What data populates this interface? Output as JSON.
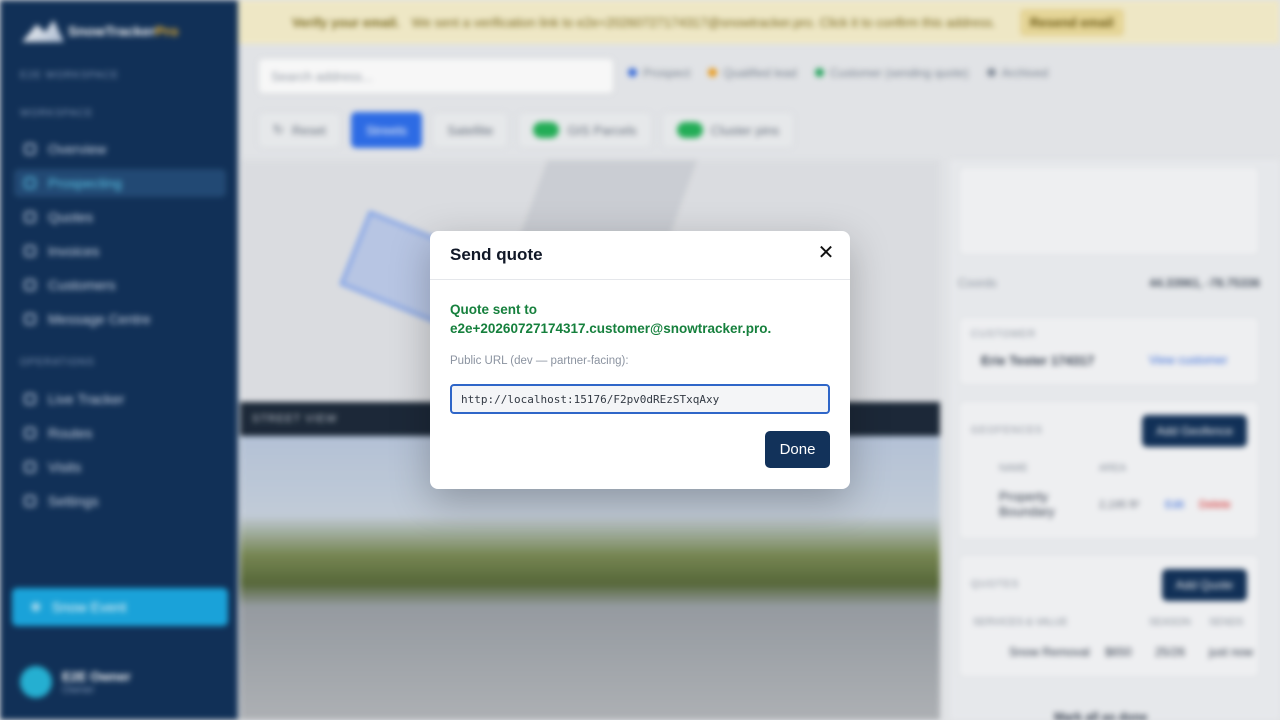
{
  "background": {
    "brand": {
      "name_a": "SnowTracker",
      "name_b": "Pro"
    },
    "workspace_label": "E2E WORKSPACE",
    "sections": {
      "workspace": "WORKSPACE",
      "operations": "OPERATIONS"
    },
    "nav": [
      {
        "label": "Overview"
      },
      {
        "label": "Prospecting"
      },
      {
        "label": "Quotes"
      },
      {
        "label": "Invoices"
      },
      {
        "label": "Customers"
      },
      {
        "label": "Message Centre"
      },
      {
        "label": "Live Tracker"
      },
      {
        "label": "Routes"
      },
      {
        "label": "Visits"
      },
      {
        "label": "Settings"
      }
    ],
    "snow_event_label": "Snow Event",
    "user": {
      "name": "E2E Owner",
      "role": "Owner"
    },
    "banner": {
      "title": "Verify your email.",
      "message": "We sent a verification link to e2e+20260727174317@snowtracker.pro. Click it to confirm this address.",
      "resend": "Resend email"
    },
    "search_placeholder": "Search address...",
    "legend": [
      {
        "label": "Prospect",
        "color": "#3b6fe0"
      },
      {
        "label": "Qualified lead",
        "color": "#f0a020"
      },
      {
        "label": "Customer (sending quote)",
        "color": "#25a860"
      },
      {
        "label": "Archived",
        "color": "#8a93a0"
      }
    ],
    "toolbar": {
      "reset": "Reset",
      "streets": "Streets",
      "satellite": "Satellite",
      "parcels": "GIS Parcels",
      "cluster": "Cluster pins"
    },
    "street_view_label": "STREET VIEW",
    "right": {
      "coords_label": "Coords",
      "coords_value": "44.33961, -78.75336",
      "customer_label": "CUSTOMER",
      "customer_name": "Erie Tester 174317",
      "view_customer": "View customer",
      "geofences_label": "GEOFENCES",
      "add_geofence": "Add Geofence",
      "geofence_cols": [
        "NAME",
        "AREA"
      ],
      "geofence_row": {
        "name": "Property Boundary",
        "area": "2,195 ft²",
        "edit": "Edit",
        "delete": "Delete"
      },
      "quotes_label": "QUOTES",
      "add_quote": "Add Quote",
      "quote_cols": [
        "SERVICES & VALUE",
        "SEASON",
        "SENDS"
      ],
      "quote_row": {
        "service": "Snow Removal",
        "value": "$650",
        "season": "25/26",
        "sends": "just now"
      },
      "footer_link": "Mark all as done"
    }
  },
  "modal": {
    "title": "Send quote",
    "sent_prefix": "Quote sent to",
    "sent_email": "e2e+20260727174317.customer@snowtracker.pro.",
    "url_label": "Public URL (dev — partner-facing):",
    "url_value": "http://localhost:15176/F2pv0dREzSTxqAxy",
    "done_label": "Done"
  }
}
